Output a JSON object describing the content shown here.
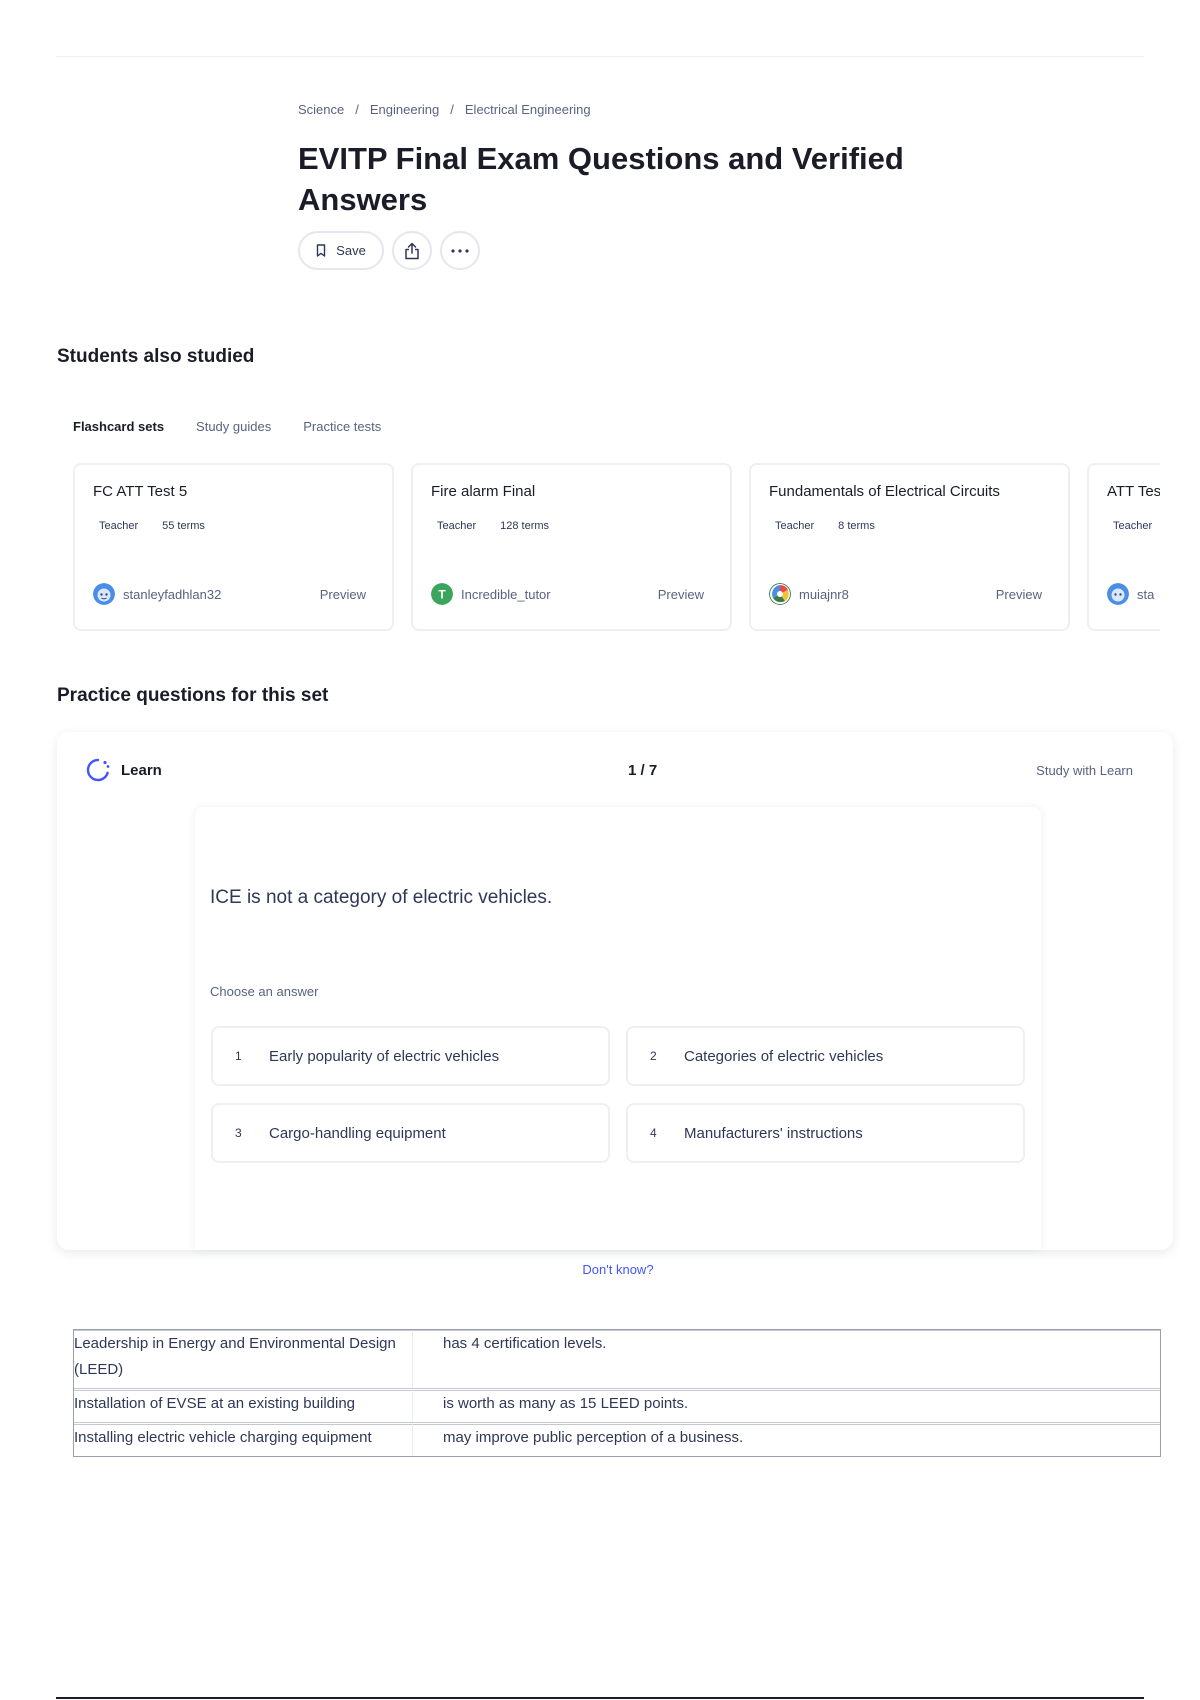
{
  "breadcrumb": [
    "Science",
    "Engineering",
    "Electrical Engineering"
  ],
  "breadcrumb_separator": "/",
  "title": "EVITP Final Exam Questions and Verified Answers",
  "actions": {
    "save_label": "Save"
  },
  "students_also_studied": {
    "heading": "Students also studied",
    "tabs": [
      "Flashcard sets",
      "Study guides",
      "Practice tests"
    ],
    "active_tab": "Flashcard sets",
    "cards": [
      {
        "title": "FC ATT Test 5",
        "role": "Teacher",
        "terms": "55 terms",
        "author": "stanleyfadhlan32",
        "preview": "Preview"
      },
      {
        "title": "Fire alarm Final",
        "role": "Teacher",
        "terms": "128 terms",
        "author": "Incredible_tutor",
        "preview": "Preview"
      },
      {
        "title": "Fundamentals of Electrical Circuits",
        "role": "Teacher",
        "terms": "8 terms",
        "author": "muiajnr8",
        "preview": "Preview"
      },
      {
        "title": "ATT Tes",
        "role": "Teacher",
        "terms": "",
        "author": "sta",
        "preview": ""
      }
    ]
  },
  "practice": {
    "heading": "Practice questions for this set",
    "mode_label": "Learn",
    "progress": "1 / 7",
    "study_link": "Study with Learn",
    "question": "ICE is not a category of electric vehicles.",
    "choose_label": "Choose an answer",
    "options": [
      {
        "num": "1",
        "text": "Early popularity of electric vehicles"
      },
      {
        "num": "2",
        "text": "Categories of electric vehicles"
      },
      {
        "num": "3",
        "text": "Cargo-handling equipment"
      },
      {
        "num": "4",
        "text": "Manufacturers' instructions"
      }
    ],
    "dont_know": "Don't know?"
  },
  "terms": [
    {
      "term": "Leadership in Energy and Environmental Design (LEED)",
      "definition": "has 4 certification levels."
    },
    {
      "term": "Installation of EVSE at an existing building",
      "definition": "is worth as many as 15 LEED points."
    },
    {
      "term": "Installing electric vehicle charging equipment",
      "definition": "may improve public perception of a business."
    }
  ],
  "colors": {
    "accent": "#4255ff",
    "text": "#1a1d28",
    "muted": "#586380"
  }
}
